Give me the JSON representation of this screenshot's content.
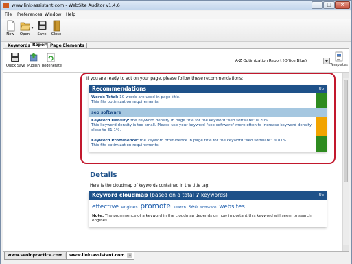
{
  "window": {
    "title": "www.link-assistant.com - WebSite Auditor v1.4.6"
  },
  "menu": [
    {
      "label": "File"
    },
    {
      "label": "Preferences"
    },
    {
      "label": "Window"
    },
    {
      "label": "Help"
    }
  ],
  "toolbar": {
    "new_label": "New",
    "open_label": "Open",
    "save_label": "Save",
    "close_label": "Close"
  },
  "tabs": [
    {
      "label": "Keywords"
    },
    {
      "label": "Report"
    },
    {
      "label": "Page Elements"
    }
  ],
  "report_toolbar": {
    "quick_save_label": "Quick Save",
    "publish_label": "Publish",
    "regenerate_label": "Regenerate",
    "template_selected": "A-Z Optimization Report (Office Blue)",
    "templates_label": "Templates"
  },
  "report": {
    "intro": "If you are ready to act on your page, please follow these recommendations:",
    "recommendations": {
      "title": "Recommendations",
      "up_link": "Up",
      "words_total_label": "Words Total:",
      "words_total_text": "10 words are used in page title.",
      "words_total_note": "This fits optimization requirements.",
      "group_label": "seo software",
      "density_label": "Keyword Density:",
      "density_text": "the keyword density in page title for the keyword \"seo software\" is 20%.",
      "density_note": "This keyword density is too small. Please use your keyword \"seo software\" more often to increase keyword density close to 31.1%.",
      "prominence_label": "Keyword Prominence:",
      "prominence_text": "the keyword prominence in page title for the keyword \"seo software\" is 81%.",
      "prominence_note": "This fits optimization requirements."
    },
    "details": {
      "title": "Details",
      "text": "Here is the cloudmap of keywords contained in the title tag:",
      "cloud_title_main": "Keyword cloudmap",
      "cloud_title_sub_pre": "(based on a total",
      "cloud_title_count": "7",
      "cloud_title_sub_post": "keywords)",
      "up_link": "Up",
      "words": [
        "effective",
        "engines",
        "promote",
        "search",
        "seo",
        "software",
        "websites"
      ],
      "note_label": "Note:",
      "note_text": "The prominence of a keyword in the cloudmap depends on how important this keyword will seem to search engines."
    }
  },
  "bottom_tabs": [
    {
      "label": "www.seoinpractice.com"
    },
    {
      "label": "www.link-assistant.com"
    }
  ],
  "colors": {
    "header_blue": "#1e5189",
    "group_blue": "#a5c7e0",
    "status_green": "#2e8b1f",
    "status_orange": "#f2a400",
    "highlight_red": "#c2182d"
  }
}
